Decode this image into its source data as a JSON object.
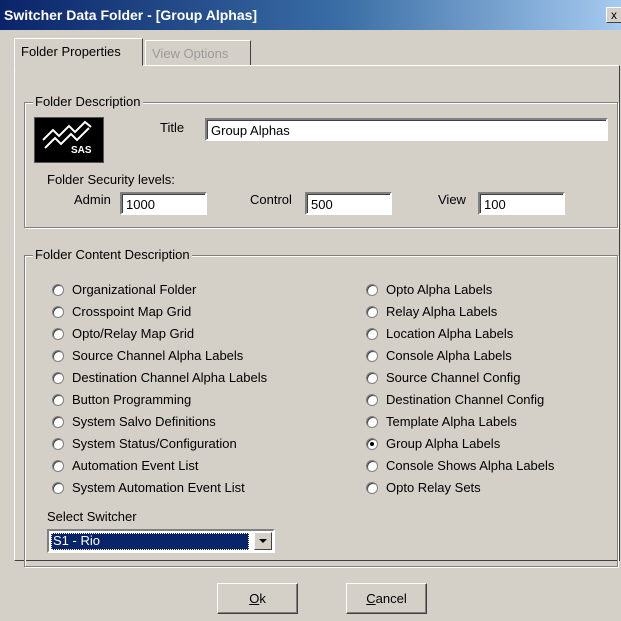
{
  "window": {
    "title": "Switcher Data Folder - [Group Alphas]",
    "close_glyph": "x"
  },
  "tabs": [
    {
      "label": "Folder Properties",
      "active": true
    },
    {
      "label": "View Options",
      "active": false
    }
  ],
  "folder_description": {
    "group_label": "Folder Description",
    "logo_text": "SAS",
    "title_label": "Title",
    "title_value": "Group Alphas",
    "security_label": "Folder Security levels:",
    "admin_label": "Admin",
    "admin_value": "1000",
    "control_label": "Control",
    "control_value": "500",
    "view_label": "View",
    "view_value": "100"
  },
  "content_description": {
    "group_label": "Folder Content Description",
    "left_options": [
      {
        "label": "Organizational Folder",
        "checked": false
      },
      {
        "label": "Crosspoint Map Grid",
        "checked": false
      },
      {
        "label": "Opto/Relay Map Grid",
        "checked": false
      },
      {
        "label": "Source Channel Alpha Labels",
        "checked": false
      },
      {
        "label": "Destination Channel Alpha Labels",
        "checked": false
      },
      {
        "label": "Button Programming",
        "checked": false
      },
      {
        "label": "System Salvo Definitions",
        "checked": false
      },
      {
        "label": "System Status/Configuration",
        "checked": false
      },
      {
        "label": "Automation Event List",
        "checked": false
      },
      {
        "label": "System Automation Event List",
        "checked": false
      }
    ],
    "right_options": [
      {
        "label": "Opto Alpha Labels",
        "checked": false
      },
      {
        "label": "Relay Alpha Labels",
        "checked": false
      },
      {
        "label": "Location Alpha Labels",
        "checked": false
      },
      {
        "label": "Console Alpha Labels",
        "checked": false
      },
      {
        "label": "Source Channel Config",
        "checked": false
      },
      {
        "label": "Destination Channel Config",
        "checked": false
      },
      {
        "label": "Template Alpha Labels",
        "checked": false
      },
      {
        "label": "Group Alpha Labels",
        "checked": true
      },
      {
        "label": "Console Shows Alpha Labels",
        "checked": false
      },
      {
        "label": "Opto Relay Sets",
        "checked": false
      }
    ],
    "switcher_label": "Select Switcher",
    "switcher_value": "S1 - Rio"
  },
  "buttons": {
    "ok_mnemonic": "O",
    "ok_rest": "k",
    "cancel_mnemonic": "C",
    "cancel_rest": "ancel"
  }
}
